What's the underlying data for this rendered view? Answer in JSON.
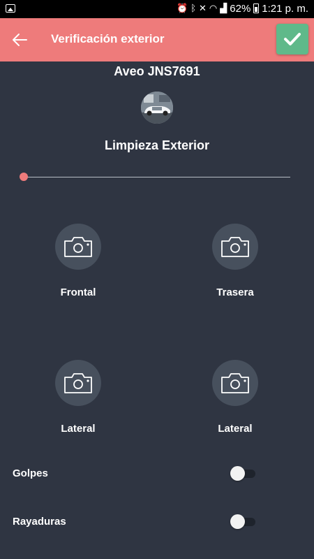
{
  "status_bar": {
    "battery": "62%",
    "time": "1:21 p. m."
  },
  "app_bar": {
    "title": "Verificación exterior"
  },
  "vehicle": {
    "title": "Aveo JNS7691"
  },
  "section": {
    "title": "Limpieza Exterior",
    "slider_value": 0
  },
  "photos": [
    {
      "label": "Frontal"
    },
    {
      "label": "Trasera"
    },
    {
      "label": "Lateral"
    },
    {
      "label": "Lateral"
    }
  ],
  "toggles": [
    {
      "label": "Golpes",
      "on": false
    },
    {
      "label": "Rayaduras",
      "on": false
    }
  ],
  "colors": {
    "accent": "#ee7b7b",
    "confirm": "#5fb98a",
    "background": "#2f3542"
  }
}
